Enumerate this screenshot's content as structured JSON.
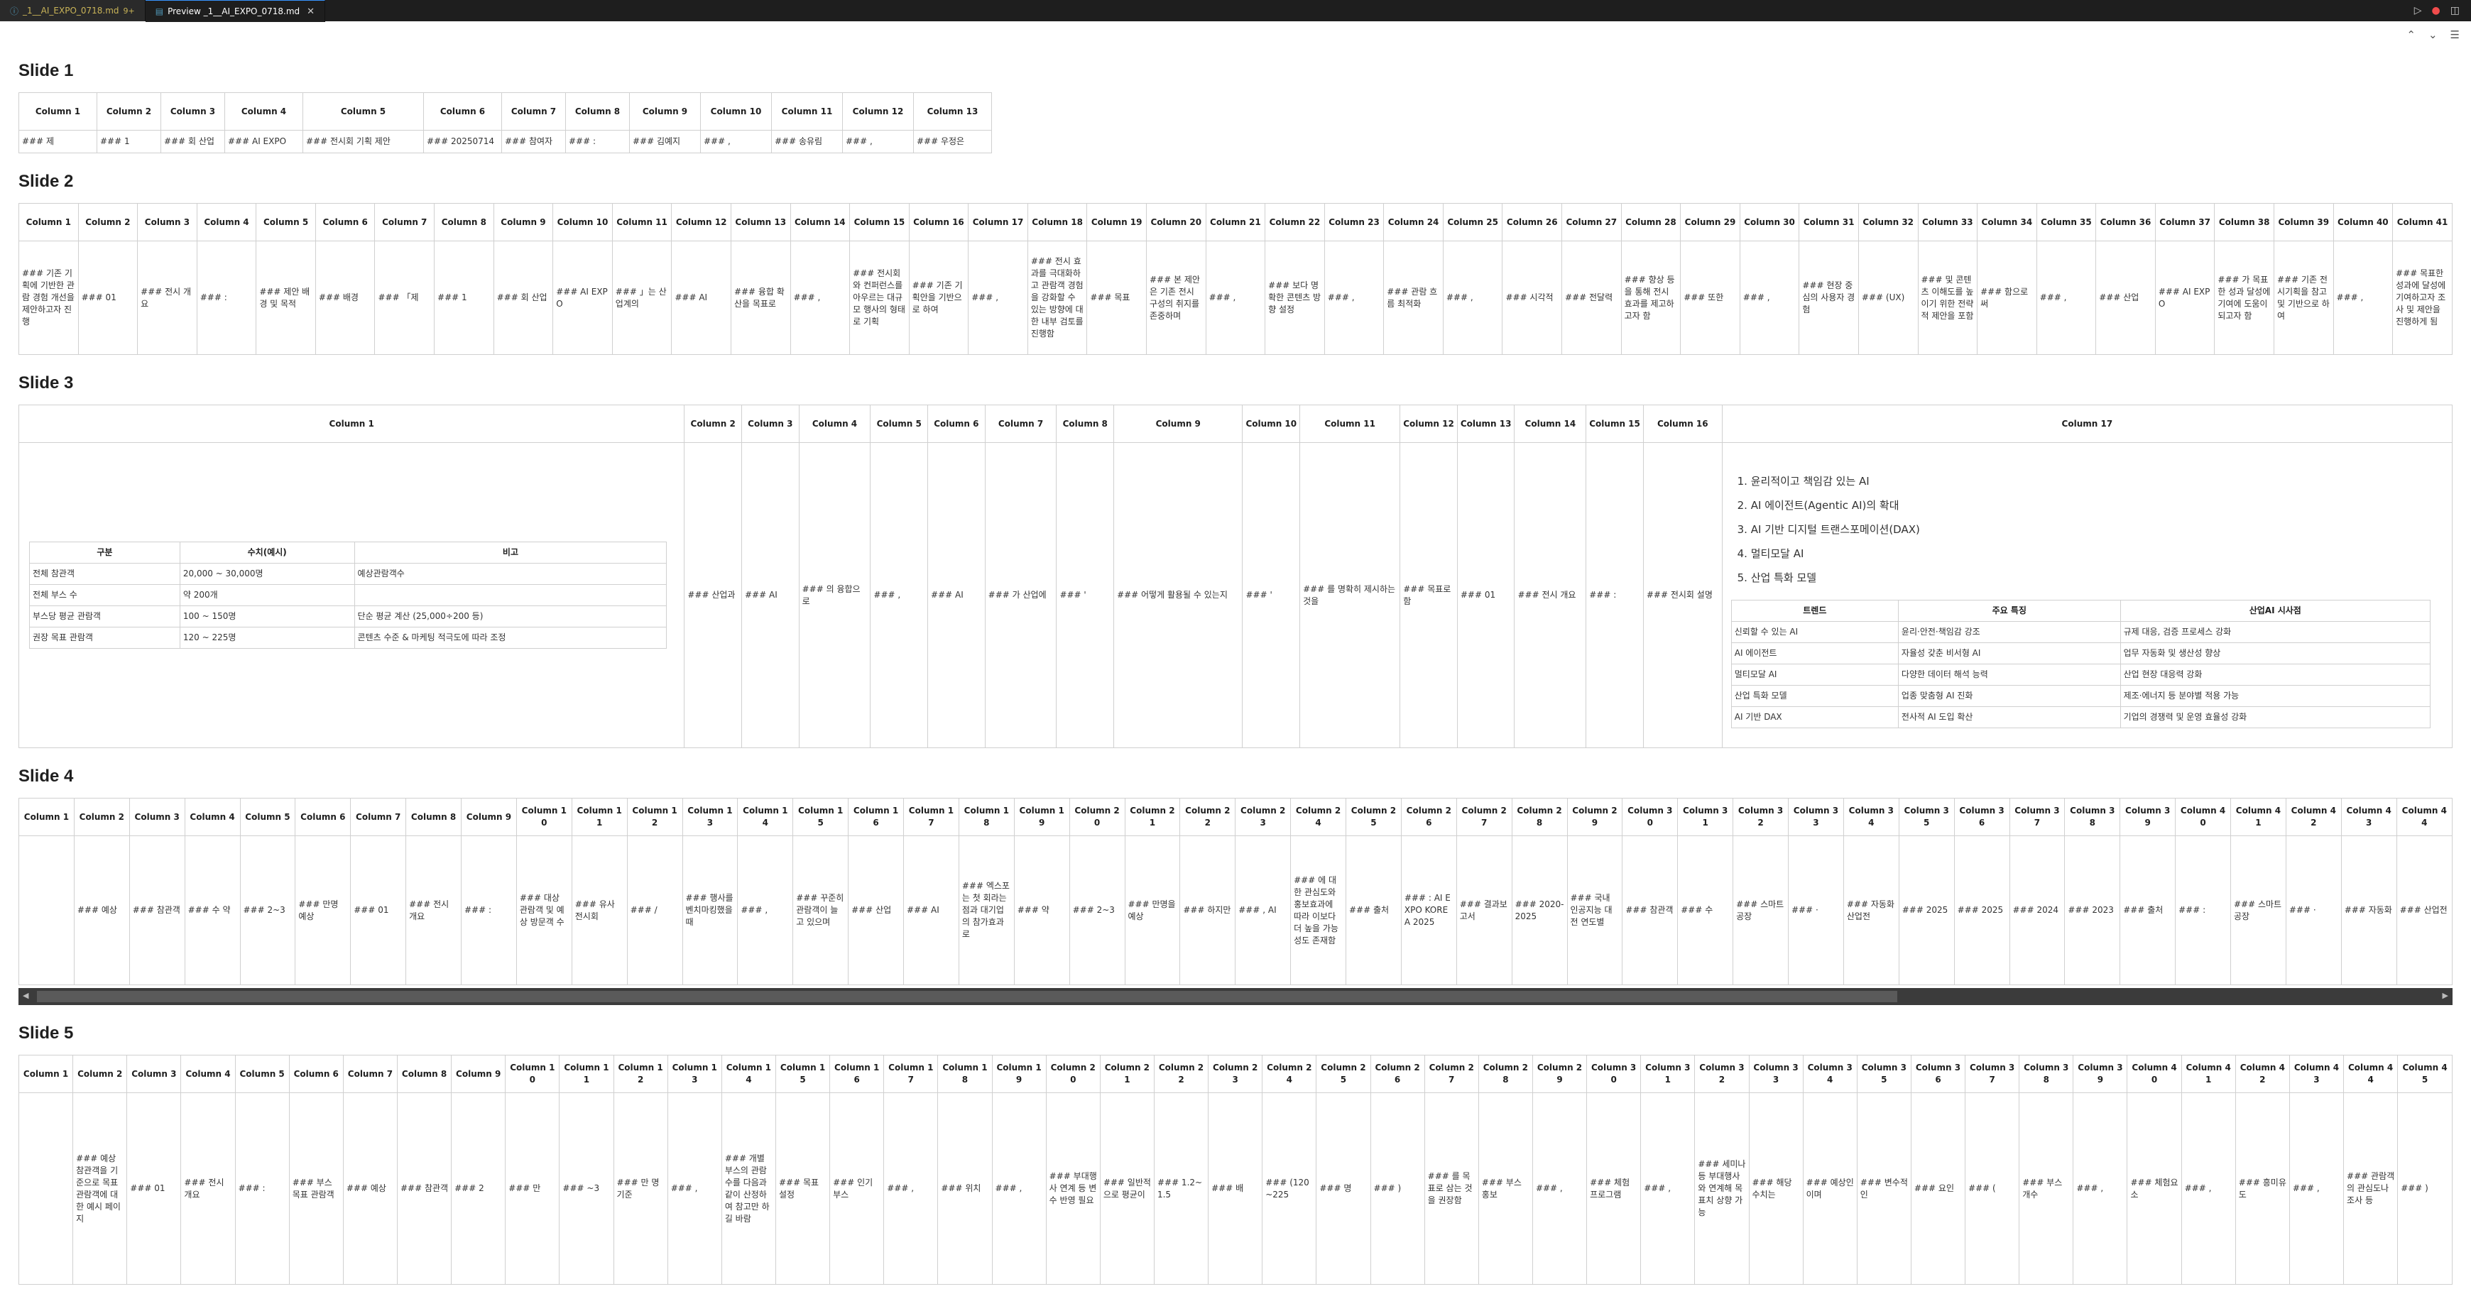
{
  "tabs": [
    {
      "label": "_1__AI_EXPO_0718.md",
      "modified": "9+"
    },
    {
      "label": "Preview _1__AI_EXPO_0718.md"
    }
  ],
  "slides": {
    "s1": {
      "title": "Slide 1",
      "headers": [
        "Column 1",
        "Column 2",
        "Column 3",
        "Column 4",
        "Column 5",
        "Column 6",
        "Column 7",
        "Column 8",
        "Column 9",
        "Column 10",
        "Column 11",
        "Column 12",
        "Column 13"
      ],
      "cells": [
        "### 제",
        "### 1",
        "### 회 산업",
        "### AI EXPO",
        "### 전시회 기획 제안",
        "### 20250714",
        "### 참여자",
        "### :",
        "### 김예지",
        "### ,",
        "### 송유림",
        "### ,",
        "### 우정은"
      ]
    },
    "s2": {
      "title": "Slide 2",
      "headers": [
        "Column 1",
        "Column 2",
        "Column 3",
        "Column 4",
        "Column 5",
        "Column 6",
        "Column 7",
        "Column 8",
        "Column 9",
        "Column 10",
        "Column 11",
        "Column 12",
        "Column 13",
        "Column 14",
        "Column 15",
        "Column 16",
        "Column 17",
        "Column 18",
        "Column 19",
        "Column 20",
        "Column 21",
        "Column 22",
        "Column 23",
        "Column 24",
        "Column 25",
        "Column 26",
        "Column 27",
        "Column 28",
        "Column 29",
        "Column 30",
        "Column 31",
        "Column 32",
        "Column 33",
        "Column 34",
        "Column 35",
        "Column 36",
        "Column 37",
        "Column 38",
        "Column 39",
        "Column 40",
        "Column 41"
      ],
      "cells": [
        "### 기존 기획에 기반한 관람 경험 개선을 제안하고자 진행",
        "### 01",
        "### 전시 개요",
        "### :",
        "### 제안 배경 및 목적",
        "### 배경",
        "### 「제",
        "### 1",
        "### 회 산업",
        "### AI EXPO",
        "### 」는 산업계의",
        "### AI",
        "### 융합 확산을 목표로",
        "### ,",
        "### 전시회와 컨퍼런스를 아우르는 대규모 행사의 형태로 기획",
        "### 기존 기획안을 기반으로 하여",
        "### ,",
        "### 전시 효과를 극대화하고 관람객 경험을 강화할 수 있는 방향에 대한 내부 검토를 진행함",
        "### 목표",
        "### 본 제안은 기존 전시 구성의 취지를 존중하며",
        "### ,",
        "### 보다 명확한 콘텐츠 방향 설정",
        "### ,",
        "### 관람 흐름 최적화",
        "### ,",
        "### 시각적",
        "### 전달력",
        "### 향상 등을 통해 전시 효과를 제고하고자 함",
        "### 또한",
        "### ,",
        "### 현장 중심의 사용자 경험",
        "### (UX)",
        "### 및 콘텐츠 이해도를 높이기 위한 전략적 제안을 포함",
        "### 함으로써",
        "### ,",
        "### 산업",
        "### AI EXPO",
        "### 가 목표한 성과 달성에 기여에 도움이 되고자 함",
        "### 기존 전시기획을 참고 및 기반으로 하여",
        "### ,",
        "### 목표한 성과에 달성에 기여하고자 조사 및 제안을 진행하게 됨"
      ]
    },
    "s3": {
      "title": "Slide 3",
      "headers": [
        "Column 1",
        "Column 2",
        "Column 3",
        "Column 4",
        "Column 5",
        "Column 6",
        "Column 7",
        "Column 8",
        "Column 9",
        "Column 10",
        "Column 11",
        "Column 12",
        "Column 13",
        "Column 14",
        "Column 15",
        "Column 16",
        "Column 17"
      ],
      "cells": [
        "### 산업과",
        "### AI",
        "### 의 융합으로",
        "### ,",
        "### AI",
        "### 가 산업에",
        "### '",
        "### 어떻게 활용될 수 있는지",
        "### '",
        "### 를 명확히 제시하는 것을",
        "### 목표로함",
        "### 01",
        "### 전시 개요",
        "### :",
        "### 전시회 설명"
      ],
      "visitor_table": {
        "headers": [
          "구분",
          "수치(예시)",
          "비고"
        ],
        "rows": [
          [
            "전체 참관객",
            "20,000 ~ 30,000명",
            "예상관람객수"
          ],
          [
            "전체 부스 수",
            "약 200개",
            ""
          ],
          [
            "부스당 평균 관람객",
            "100 ~ 150명",
            "단순 평균 계산 (25,000÷200 등)"
          ],
          [
            "권장 목표 관람객",
            "120 ~ 225명",
            "콘텐츠 수준 & 마케팅 적극도에 따라 조정"
          ]
        ]
      },
      "trend_list": [
        "윤리적이고 책임감 있는 AI",
        "AI 에이전트(Agentic AI)의 확대",
        "AI 기반 디지털 트랜스포메이션(DAX)",
        "멀티모달 AI",
        "산업 특화 모델"
      ],
      "trend_table": {
        "headers": [
          "트렌드",
          "주요 특징",
          "산업AI 시사점"
        ],
        "rows": [
          [
            "신뢰할 수 있는 AI",
            "윤리·안전·책임감 강조",
            "규제 대응, 검증 프로세스 강화"
          ],
          [
            "AI 에이전트",
            "자율성 갖춘 비서형 AI",
            "업무 자동화 및 생산성 향상"
          ],
          [
            "멀티모달 AI",
            "다양한 데이터 해석 능력",
            "산업 현장 대응력 강화"
          ],
          [
            "산업 특화 모델",
            "업종 맞춤형 AI 진화",
            "제조·에너지 등 분야별 적용 가능"
          ],
          [
            "AI 기반 DAX",
            "전사적 AI 도입 확산",
            "기업의 경쟁력 및 운영 효율성 강화"
          ]
        ]
      }
    },
    "s4": {
      "title": "Slide 4",
      "headers": [
        "Column 1",
        "Column 2",
        "Column 3",
        "Column 4",
        "Column 5",
        "Column 6",
        "Column 7",
        "Column 8",
        "Column 9",
        "Column 10",
        "Column 11",
        "Column 12",
        "Column 13",
        "Column 14",
        "Column 15",
        "Column 16",
        "Column 17",
        "Column 18",
        "Column 19",
        "Column 20",
        "Column 21",
        "Column 22",
        "Column 23",
        "Column 24",
        "Column 25",
        "Column 26",
        "Column 27",
        "Column 28",
        "Column 29",
        "Column 30",
        "Column 31",
        "Column 32",
        "Column 33",
        "Column 34",
        "Column 35",
        "Column 36",
        "Column 37",
        "Column 38",
        "Column 39",
        "Column 40",
        "Column 41",
        "Column 42",
        "Column 43",
        "Column 44"
      ],
      "cells": [
        "",
        "### 예상",
        "### 참관객",
        "### 수 약",
        "### 2~3",
        "### 만명 예상",
        "### 01",
        "### 전시 개요",
        "### :",
        "### 대상 관람객 및 예상 방문객 수",
        "### 유사 전시회",
        "### /",
        "### 행사를 벤치마킹했을 때",
        "### ,",
        "### 꾸준히 관람객이 늘고 있으며",
        "### 산업",
        "### AI",
        "### 엑스포는 첫 회라는 점과 대기업의 참가효과로",
        "### 약",
        "### 2~3",
        "### 만명을 예상",
        "### 하지만",
        "### , AI",
        "### 에 대한 관심도와 홍보효과에 따라 이보다 더 높을 가능성도 존재함",
        "### 출처",
        "### : AI EXPO KOREA 2025",
        "### 결과보고서",
        "### 2020-2025",
        "### 국내 인공지능 대전 연도별",
        "### 참관객",
        "### 수",
        "### 스마트공장",
        "### ·",
        "### 자동화산업전",
        "### 2025",
        "### 2025",
        "### 2024",
        "### 2023",
        "### 출처",
        "### :",
        "### 스마트공장",
        "### ·",
        "### 자동화",
        "### 산업전"
      ]
    },
    "s5": {
      "title": "Slide 5",
      "headers": [
        "Column 1",
        "Column 2",
        "Column 3",
        "Column 4",
        "Column 5",
        "Column 6",
        "Column 7",
        "Column 8",
        "Column 9",
        "Column 10",
        "Column 11",
        "Column 12",
        "Column 13",
        "Column 14",
        "Column 15",
        "Column 16",
        "Column 17",
        "Column 18",
        "Column 19",
        "Column 20",
        "Column 21",
        "Column 22",
        "Column 23",
        "Column 24",
        "Column 25",
        "Column 26",
        "Column 27",
        "Column 28",
        "Column 29",
        "Column 30",
        "Column 31",
        "Column 32",
        "Column 33",
        "Column 34",
        "Column 35",
        "Column 36",
        "Column 37",
        "Column 38",
        "Column 39",
        "Column 40",
        "Column 41",
        "Column 42",
        "Column 43",
        "Column 44",
        "Column 45"
      ],
      "cells": [
        "",
        "### 예상 참관객을 기준으로 목표 관람객에 대한 예시 페이지",
        "### 01",
        "### 전시 개요",
        "### :",
        "### 부스 목표 관람객",
        "### 예상",
        "### 참관객",
        "### 2",
        "### 만",
        "### ~3",
        "### 만 명 기준",
        "### ,",
        "### 개별 부스의 관람 수를 다음과 같이 산정하여 참고만 하길 바람",
        "### 목표 설정",
        "### 인기 부스",
        "### ,",
        "### 위치",
        "### ,",
        "### 부대행사 연계 등 변수 반영 필요",
        "### 일반적으로 평균이",
        "### 1.2~1.5",
        "### 배",
        "### (120~225",
        "### 명",
        "### )",
        "### 를 목표로 삼는 것을 권장함",
        "### 부스 홍보",
        "### ,",
        "### 체험 프로그램",
        "### ,",
        "### 세미나 등 부대행사와 연계해 목표치 상향 가능",
        "### 해당 수치는",
        "### 예상인이며",
        "### 변수적인",
        "### 요인",
        "### (",
        "### 부스 개수",
        "### ,",
        "### 체험요소",
        "### ,",
        "### 흥미유도",
        "### ,",
        "### 관람객의 관심도나 조사 등",
        "### )"
      ]
    }
  }
}
